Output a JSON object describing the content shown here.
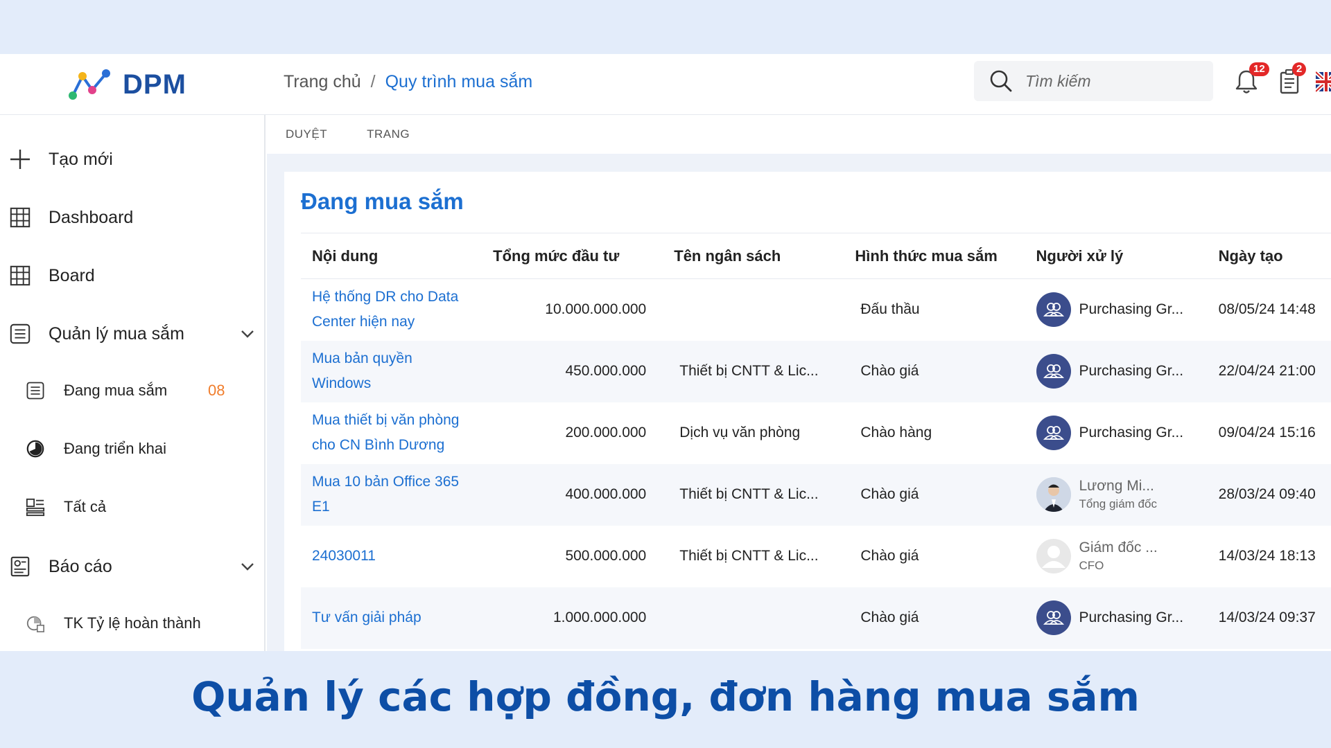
{
  "app": {
    "logo_text": "DPM",
    "brand_color": "#1c4fa0",
    "accent_color": "#1c6fd1"
  },
  "breadcrumb": {
    "home": "Trang chủ",
    "separator": "/",
    "current": "Quy trình mua sắm"
  },
  "search": {
    "placeholder": "Tìm kiếm",
    "icon": "search-icon"
  },
  "header_actions": {
    "notifications": {
      "icon": "bell-icon",
      "badge": "12"
    },
    "tasks": {
      "icon": "clipboard-icon",
      "badge": "2"
    },
    "language": {
      "icon": "uk-flag-icon"
    }
  },
  "sidebar": {
    "items": [
      {
        "label": "Tạo mới",
        "icon": "plus-icon"
      },
      {
        "label": "Dashboard",
        "icon": "grid-icon"
      },
      {
        "label": "Board",
        "icon": "grid-icon"
      },
      {
        "label": "Quản lý mua sắm",
        "icon": "list-icon",
        "expandable": true
      },
      {
        "label": "Đang mua sắm",
        "icon": "list-icon",
        "count": "08",
        "sub": true
      },
      {
        "label": "Đang triển khai",
        "icon": "progress-icon",
        "sub": true
      },
      {
        "label": "Tất cả",
        "icon": "layout-icon",
        "sub": true
      },
      {
        "label": "Báo cáo",
        "icon": "report-icon",
        "expandable": true
      },
      {
        "label": "TK Tỷ lệ hoàn thành",
        "icon": "chart-icon",
        "sub": true
      }
    ]
  },
  "tabs": [
    {
      "label": "DUYỆT"
    },
    {
      "label": "TRANG"
    }
  ],
  "main": {
    "title": "Đang mua sắm",
    "columns": [
      "Nội dung",
      "Tổng mức đầu tư",
      "Tên ngân sách",
      "Hình thức mua sắm",
      "Người xử lý",
      "Ngày tạo"
    ],
    "rows": [
      {
        "content": "Hệ thống DR cho Data Center hiện nay",
        "amount": "10.000.000.000",
        "budget": "",
        "method": "Đấu thầu",
        "person": "Purchasing Gr...",
        "role": "",
        "avatar": "group",
        "date": "08/05/24 14:48"
      },
      {
        "content": "Mua bản quyền Windows",
        "amount": "450.000.000",
        "budget": "Thiết bị CNTT & Lic...",
        "method": "Chào giá",
        "person": "Purchasing Gr...",
        "role": "",
        "avatar": "group",
        "date": "22/04/24 21:00"
      },
      {
        "content": "Mua thiết bị văn phòng cho CN Bình Dương",
        "amount": "200.000.000",
        "budget": "Dịch vụ văn phòng",
        "method": "Chào hàng",
        "person": "Purchasing Gr...",
        "role": "",
        "avatar": "group",
        "date": "09/04/24 15:16"
      },
      {
        "content": "Mua 10 bản Office 365 E1",
        "amount": "400.000.000",
        "budget": "Thiết bị CNTT & Lic...",
        "method": "Chào giá",
        "person": "Lương Mi...",
        "role": "Tổng giám đốc",
        "avatar": "photo",
        "date": "28/03/24 09:40"
      },
      {
        "content": "24030011",
        "amount": "500.000.000",
        "budget": "Thiết bị CNTT & Lic...",
        "method": "Chào giá",
        "person": "Giám đốc ...",
        "role": "CFO",
        "avatar": "grey",
        "date": "14/03/24 18:13"
      },
      {
        "content": "Tư vấn giải pháp",
        "amount": "1.000.000.000",
        "budget": "",
        "method": "Chào giá",
        "person": "Purchasing Gr...",
        "role": "",
        "avatar": "group",
        "date": "14/03/24 09:37"
      }
    ]
  },
  "caption": "Quản lý các hợp đồng, đơn hàng mua sắm"
}
